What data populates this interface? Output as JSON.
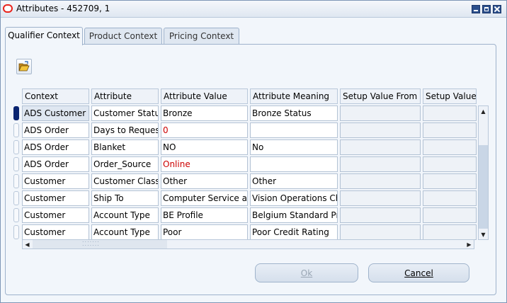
{
  "window": {
    "title": "Attributes - 452709, 1"
  },
  "tabs": [
    {
      "label": "Qualifier Context"
    },
    {
      "label": "Product Context"
    },
    {
      "label": "Pricing Context"
    }
  ],
  "toolbar": {
    "open_icon": "folder-open-icon"
  },
  "table": {
    "columns": [
      "Context",
      "Attribute",
      "Attribute Value",
      "Attribute Meaning",
      "Setup Value From",
      "Setup Value"
    ],
    "rows": [
      [
        "ADS Customer",
        "Customer Status",
        "Bronze",
        "Bronze Status",
        "",
        ""
      ],
      [
        "ADS Order",
        "Days to Request",
        "0",
        "",
        "",
        ""
      ],
      [
        "ADS Order",
        "Blanket",
        "NO",
        "No",
        "",
        ""
      ],
      [
        "ADS Order",
        "Order_Source",
        "Online",
        "",
        "",
        ""
      ],
      [
        "Customer",
        "Customer Class",
        "Other",
        "Other",
        "",
        ""
      ],
      [
        "Customer",
        "Ship To",
        "Computer Service and Rentals",
        "Vision Operations Ch",
        "",
        ""
      ],
      [
        "Customer",
        "Account Type",
        "BE Profile",
        "Belgium Standard Pr",
        "",
        ""
      ],
      [
        "Customer",
        "Account Type",
        "Poor",
        "Poor Credit Rating",
        "",
        ""
      ]
    ]
  },
  "buttons": {
    "ok": "Ok",
    "cancel": "Cancel"
  },
  "colors": {
    "red_value": "#cc0000",
    "selected_indicator": "#0a2470"
  }
}
